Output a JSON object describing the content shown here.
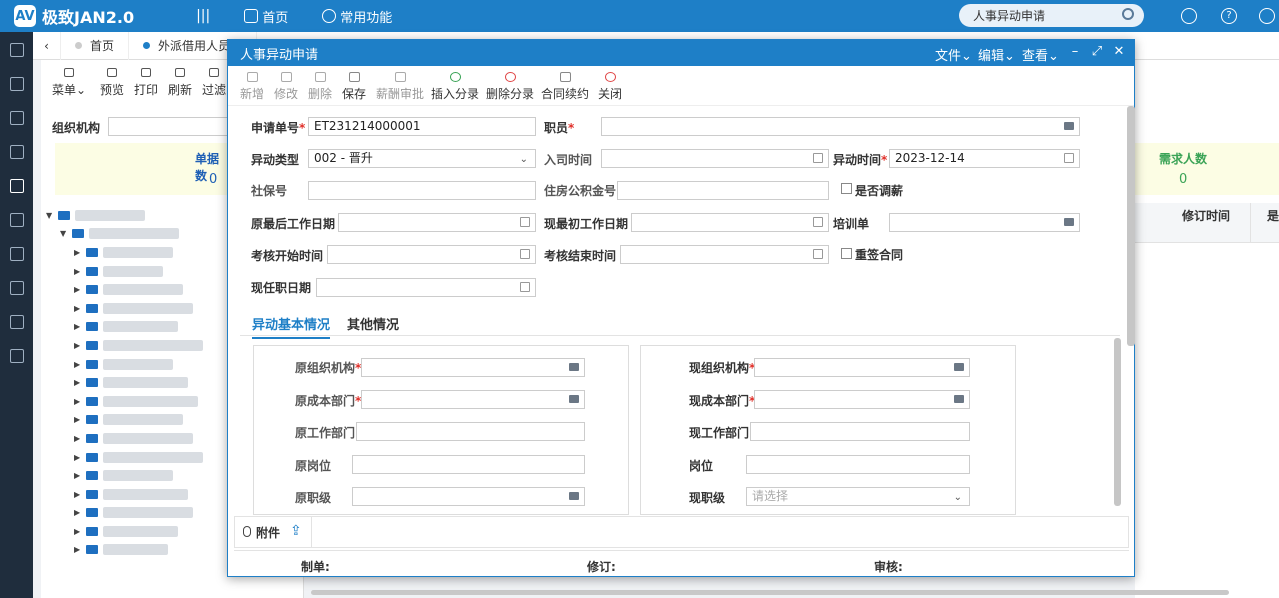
{
  "app": {
    "logo": "AV",
    "title": "极致JAN2.0"
  },
  "topnav": {
    "menu_toggle": "|||",
    "home": "首页",
    "common": "常用功能",
    "search_value": "人事异动申请"
  },
  "tabs": [
    {
      "label": "首页"
    },
    {
      "label": "外派借用人员单"
    }
  ],
  "bg_toolbar": {
    "menu": "菜单",
    "preview": "预览",
    "print": "打印",
    "refresh": "刷新",
    "filter": "过滤"
  },
  "bg_panel": {
    "org_label": "组织机构",
    "docs_label": "单据数",
    "docs_value": "0",
    "need_label": "需求人数",
    "need_value": "0",
    "col_revise_time": "修订时间",
    "col_partial": "是"
  },
  "dialog": {
    "title": "人事异动申请",
    "menus": {
      "file": "文件",
      "edit": "编辑",
      "view": "查看"
    },
    "tools": {
      "add": "新增",
      "modify": "修改",
      "delete": "删除",
      "save": "保存",
      "salary_approve": "薪酬审批",
      "insert_entry": "插入分录",
      "delete_entry": "删除分录",
      "contract_renew": "合同续约",
      "close": "关闭"
    },
    "form": {
      "doc_no_label": "申请单号",
      "doc_no_value": "ET231214000001",
      "employee_label": "职员",
      "change_type_label": "异动类型",
      "change_type_value": "002 - 晋升",
      "join_time_label": "入司时间",
      "change_time_label": "异动时间",
      "change_time_value": "2023-12-14",
      "social_no_label": "社保号",
      "housing_fund_label": "住房公积金号",
      "salary_adjust_label": "是否调薪",
      "orig_last_work_label": "原最后工作日期",
      "now_first_work_label": "现最初工作日期",
      "training_label": "培训单",
      "assess_start_label": "考核开始时间",
      "assess_end_label": "考核结束时间",
      "resign_contract_label": "重签合同",
      "now_post_date_label": "现任职日期"
    },
    "subtabs": {
      "basic": "异动基本情况",
      "other": "其他情况"
    },
    "basic": {
      "orig_org": "原组织机构",
      "orig_cost_dept": "原成本部门",
      "orig_work_dept": "原工作部门",
      "orig_post": "原岗位",
      "orig_grade": "原职级",
      "now_org": "现组织机构",
      "now_cost_dept": "现成本部门",
      "now_work_dept": "现工作部门",
      "post": "岗位",
      "now_grade": "现职级",
      "grade_placeholder": "请选择"
    },
    "attach_label": "附件",
    "footer": {
      "maker": "制单:",
      "revise": "修订:",
      "audit": "审核:"
    }
  }
}
